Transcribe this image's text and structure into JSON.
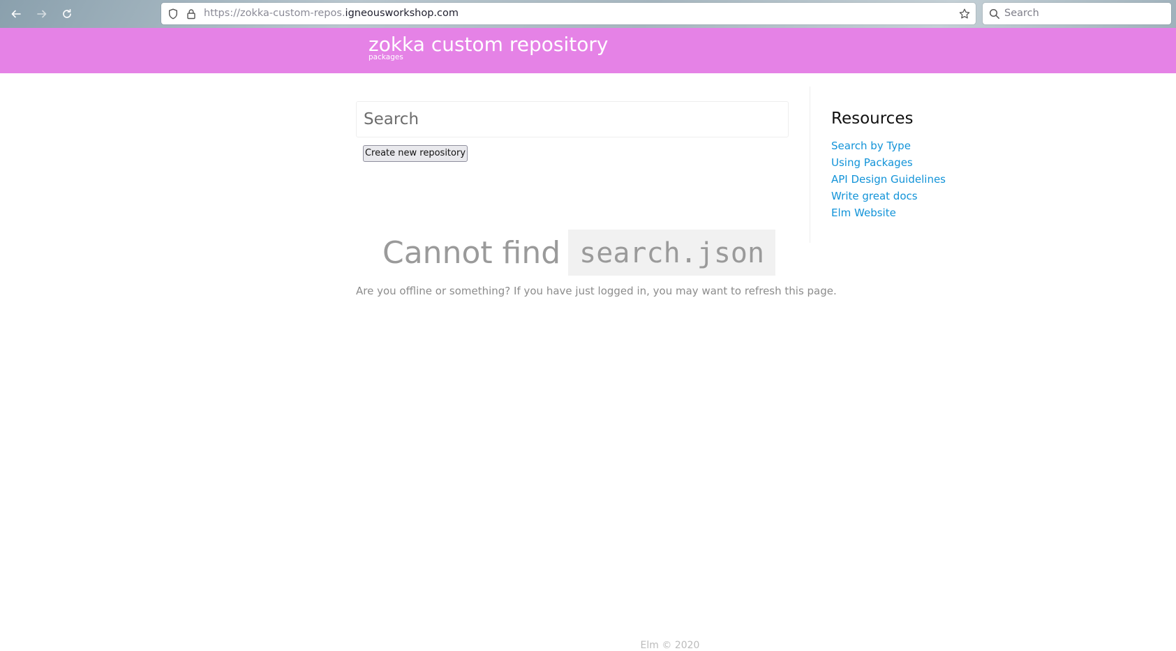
{
  "browser": {
    "url_prefix": "https://zokka-custom-repos.",
    "url_domain": "igneousworkshop.com",
    "search_placeholder": "Search",
    "icons": [
      "back-arrow-icon",
      "forward-arrow-icon",
      "reload-icon",
      "shield-icon",
      "lock-icon",
      "star-icon",
      "search-icon"
    ]
  },
  "header": {
    "title": "zokka custom repository",
    "subtitle": "packages",
    "background_color": "#e582e6"
  },
  "main": {
    "search_placeholder": "Search",
    "search_value": "",
    "create_button_label": "Create new repository",
    "error_title_text": "Cannot find",
    "error_title_code": "search.json",
    "error_message": "Are you offline or something? If you have just logged in, you may want to refresh this page."
  },
  "sidebar": {
    "title": "Resources",
    "links": [
      {
        "label": "Search by Type"
      },
      {
        "label": "Using Packages"
      },
      {
        "label": "API Design Guidelines"
      },
      {
        "label": "Write great docs"
      },
      {
        "label": "Elm Website"
      }
    ],
    "link_color": "#1293d8"
  },
  "footer": {
    "text": "Elm © 2020"
  }
}
